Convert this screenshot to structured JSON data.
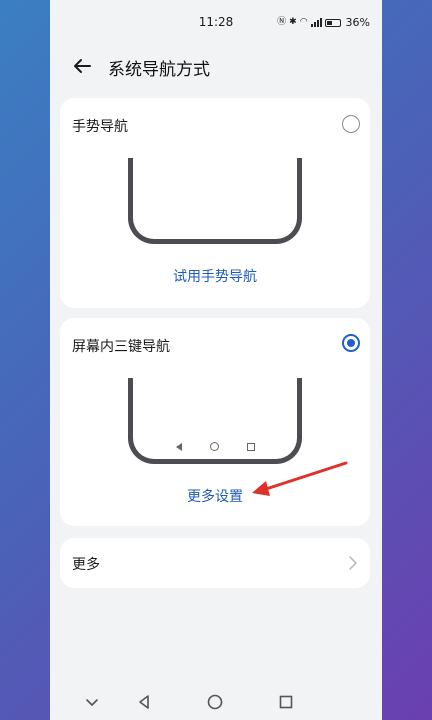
{
  "status_bar": {
    "time": "11:28",
    "battery": "36%"
  },
  "header": {
    "title": "系统导航方式"
  },
  "gesture_card": {
    "title": "手势导航",
    "link": "试用手势导航"
  },
  "three_key_card": {
    "title": "屏幕内三键导航",
    "link": "更多设置"
  },
  "more_card": {
    "label": "更多"
  },
  "colors": {
    "accent": "#1f5fd1",
    "link": "#1f5bb8",
    "annotation": "#e0302a"
  }
}
